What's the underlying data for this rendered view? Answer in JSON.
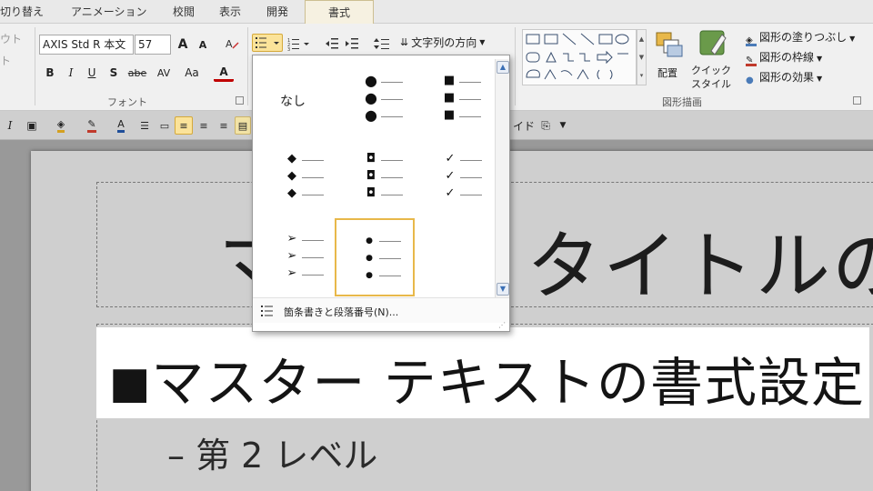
{
  "tabs": [
    "切り替え",
    "アニメーション",
    "校閲",
    "表示",
    "開発",
    "書式"
  ],
  "active_tab": "書式",
  "ribbon": {
    "partial_left_top": "ウト",
    "partial_left_bottom": "ト",
    "font_name": "AXIS Std R 本文",
    "font_size": "57",
    "grow_label": "A",
    "shrink_label": "A",
    "bold": "B",
    "italic": "I",
    "underline": "U",
    "shadow": "S",
    "strike": "abe",
    "spacing": "AV",
    "case": "Aa",
    "font_color": "A",
    "font_group_label": "フォント",
    "text_direction": "文字列の方向",
    "arrange_label": "配置",
    "quick_style_label1": "クイック",
    "quick_style_label2": "スタイル",
    "shape_fill": "図形の塗りつぶし",
    "shape_outline": "図形の枠線",
    "shape_effects": "図形の効果",
    "shape_group_label": "図形描画"
  },
  "qbar": {
    "partial_label": "イド"
  },
  "gallery": {
    "none_label": "なし",
    "selected_index": 7,
    "footer_label": "箇条書きと段落番号(N)..."
  },
  "slide": {
    "title_partial_left": "マ",
    "title_partial_right": "タイトルの",
    "body_bullet": "■",
    "body_text": "マスター テキストの書式設定",
    "level2_text": "– 第 2 レベル"
  },
  "colors": {
    "accent_selection": "#e8b84a",
    "ribbon_bg": "#f0f0f0"
  }
}
